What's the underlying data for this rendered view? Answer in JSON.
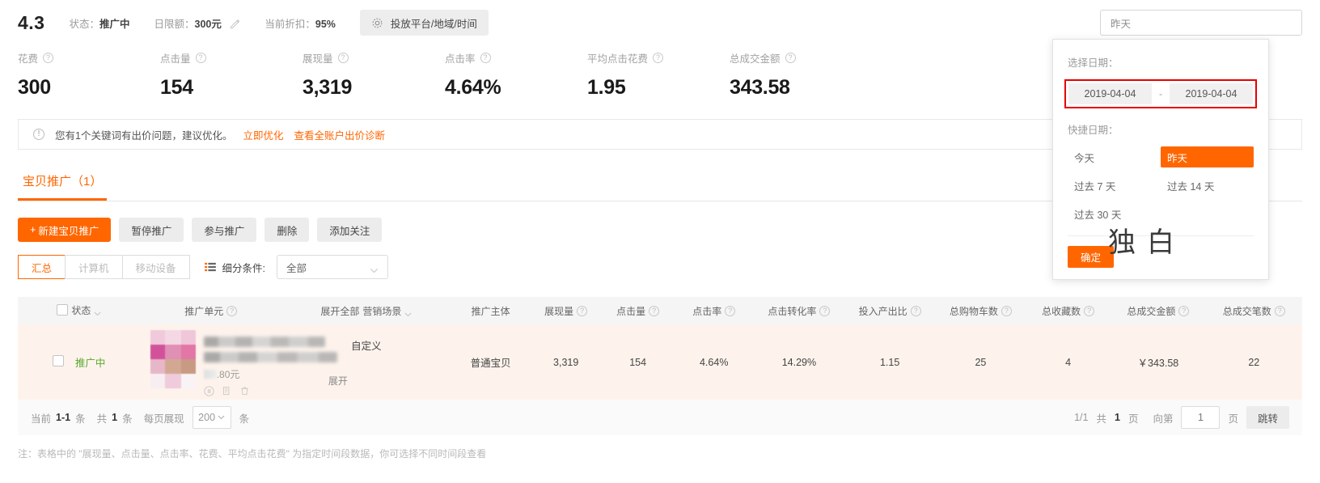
{
  "header": {
    "score": "4.3",
    "status_label": "状态：",
    "status_value": "推广中",
    "daily_budget_label": "日限额：",
    "daily_budget_value": "300元",
    "discount_label": "当前折扣：",
    "discount_value": "95%",
    "platform_button": "投放平台/地域/时间",
    "date_input_value": "昨天"
  },
  "metrics": [
    {
      "label": "花费",
      "value": "300"
    },
    {
      "label": "点击量",
      "value": "154"
    },
    {
      "label": "展现量",
      "value": "3,319"
    },
    {
      "label": "点击率",
      "value": "4.64%"
    },
    {
      "label": "平均点击花费",
      "value": "1.95"
    },
    {
      "label": "总成交金额",
      "value": "343.58"
    }
  ],
  "alert": {
    "text": "您有1个关键词有出价问题，建议优化。",
    "link1": "立即优化",
    "link2": "查看全账户出价诊断"
  },
  "tabs": [
    {
      "label": "宝贝推广（1）"
    }
  ],
  "actions": [
    {
      "label": "新建宝贝推广",
      "style": "primary"
    },
    {
      "label": "暂停推广",
      "style": "default"
    },
    {
      "label": "参与推广",
      "style": "default"
    },
    {
      "label": "删除",
      "style": "default"
    },
    {
      "label": "添加关注",
      "style": "default"
    }
  ],
  "filters": {
    "segments": [
      {
        "label": "汇总",
        "active": true
      },
      {
        "label": "计算机",
        "active": false
      },
      {
        "label": "移动设备",
        "active": false
      }
    ],
    "condition_label": "细分条件:",
    "condition_value": "全部"
  },
  "table": {
    "columns": [
      {
        "label": "状态",
        "sortable": true,
        "help": false
      },
      {
        "label": "推广单元",
        "sortable": false,
        "help": true
      },
      {
        "label": "营销场景",
        "sortable": true,
        "help": false,
        "prefix": "展开全部"
      },
      {
        "label": "推广主体",
        "sortable": false,
        "help": false
      },
      {
        "label": "展现量",
        "sortable": false,
        "help": true
      },
      {
        "label": "点击量",
        "sortable": false,
        "help": true
      },
      {
        "label": "点击率",
        "sortable": false,
        "help": true
      },
      {
        "label": "点击转化率",
        "sortable": false,
        "help": true
      },
      {
        "label": "投入产出比",
        "sortable": false,
        "help": true
      },
      {
        "label": "总购物车数",
        "sortable": false,
        "help": true
      },
      {
        "label": "总收藏数",
        "sortable": false,
        "help": true
      },
      {
        "label": "总成交金额",
        "sortable": false,
        "help": true
      },
      {
        "label": "总成交笔数",
        "sortable": false,
        "help": true
      }
    ],
    "rows": [
      {
        "status": "推广中",
        "product_price": ".80元",
        "expand_label": "展开",
        "scene": "自定义",
        "subject": "普通宝贝",
        "impressions": "3,319",
        "clicks": "154",
        "ctr": "4.64%",
        "click_conversion": "14.29%",
        "roi": "1.15",
        "carts": "25",
        "favorites": "4",
        "gmv": "￥343.58",
        "orders": "22"
      }
    ]
  },
  "pagination": {
    "current_range_prefix": "当前",
    "current_range": "1-1",
    "current_range_suffix": "条",
    "total_prefix": "共",
    "total_count": "1",
    "total_suffix": "条",
    "per_page_label": "每页展现",
    "per_page_value": "200",
    "per_page_unit": "条",
    "page_indicator": "1/1",
    "pages_prefix": "共",
    "pages_count": "1",
    "pages_suffix": "页",
    "goto_label": "向第",
    "goto_value": "1",
    "goto_unit": "页",
    "jump_button": "跳转"
  },
  "footnote": "注：表格中的 \"展现量、点击量、点击率、花费、平均点击花费\" 为指定时间段数据，你可选择不同时间段查看",
  "date_popover": {
    "select_date_label": "选择日期：",
    "start_date": "2019-04-04",
    "end_date": "2019-04-04",
    "range_separator": "-",
    "quick_label": "快捷日期：",
    "quick_options": [
      {
        "label": "今天",
        "active": false
      },
      {
        "label": "昨天",
        "active": true
      },
      {
        "label": "过去 7 天",
        "active": false
      },
      {
        "label": "过去 14 天",
        "active": false
      },
      {
        "label": "过去 30 天",
        "active": false
      }
    ],
    "confirm_label": "确定"
  },
  "watermark": "独白",
  "colors": {
    "accent": "#ff6600",
    "highlight_border": "#e60000",
    "row_background": "#fdf3ec",
    "status_green": "#5aa82e"
  }
}
